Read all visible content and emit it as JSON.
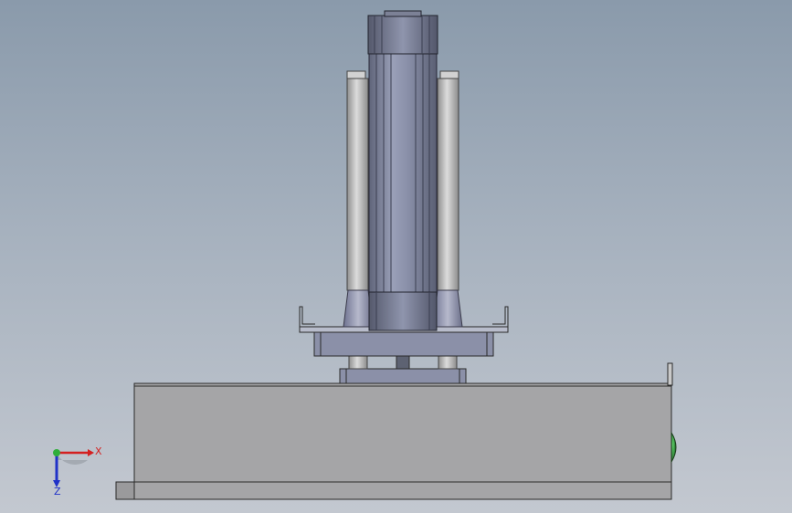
{
  "viewport": {
    "background_top": "#8a9aab",
    "background_bottom": "#c3c8d0"
  },
  "triad": {
    "x_label": "X",
    "z_label": "Z",
    "x_color": "#d42020",
    "y_color": "#2fae3a",
    "z_color": "#2032c8"
  },
  "colors": {
    "enclosure": "#a5a5a7",
    "enclosure_edge": "#2a2a2a",
    "motor_body": "#8a8fa6",
    "cylinder": "#bdbdbd",
    "indicator": "#2b8a34"
  }
}
